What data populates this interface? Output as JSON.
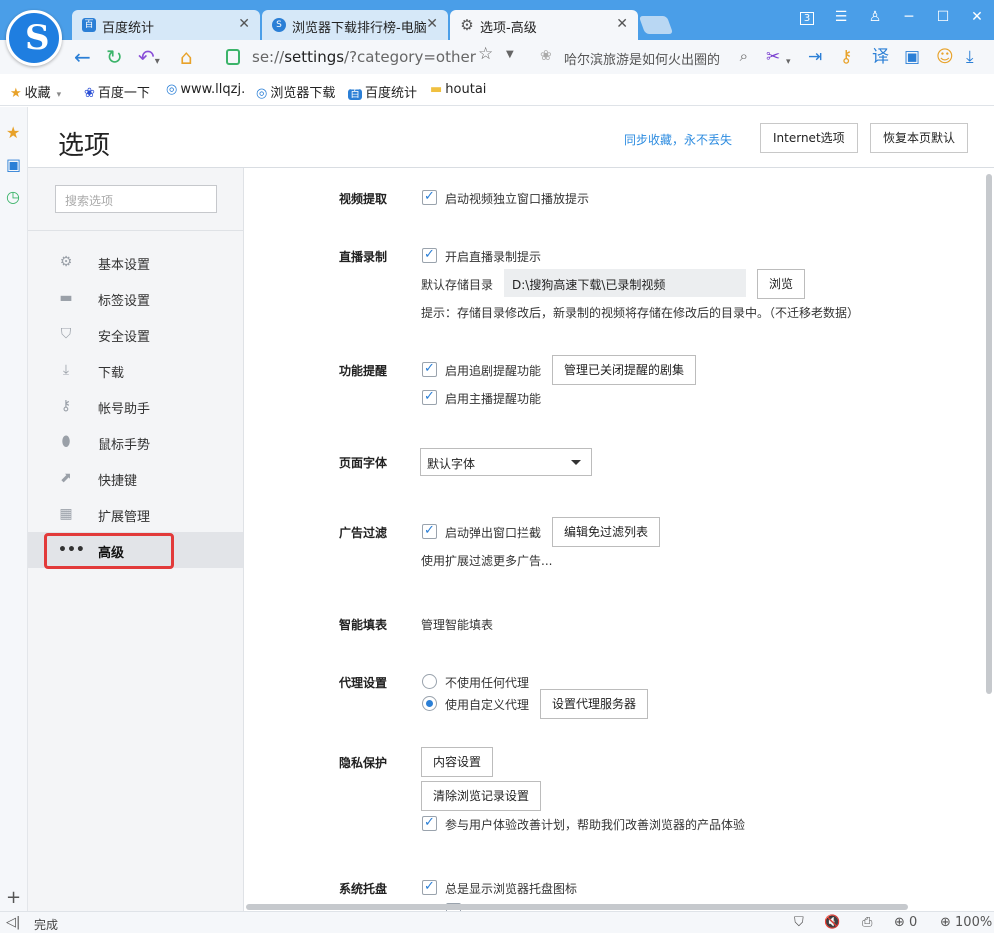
{
  "browser": {
    "tabs": [
      {
        "title": "百度统计",
        "icon": "baidu-tongji-icon"
      },
      {
        "title": "浏览器下载排行榜-电脑",
        "icon": "sogou-icon"
      },
      {
        "title": "选项-高级",
        "icon": "gear-icon"
      }
    ],
    "window_badge": "3",
    "url_prefix": "se://",
    "url_main": "settings",
    "url_suffix": "/?category=other",
    "search_text": "哈尔滨旅游是如何火出圈的",
    "bookmarks": [
      {
        "label": "收藏",
        "icon": "star-icon"
      },
      {
        "label": "百度一下",
        "icon": "baidu-paw-icon"
      },
      {
        "label": "www.llqzj.",
        "icon": "sogou-icon"
      },
      {
        "label": "浏览器下载",
        "icon": "sogou-icon"
      },
      {
        "label": "百度统计",
        "icon": "baidu-tongji-icon"
      },
      {
        "label": "houtai",
        "icon": "folder-icon"
      }
    ],
    "status": "完成",
    "zoom": "100%",
    "download_count": "0"
  },
  "settings": {
    "title": "选项",
    "sync_link": "同步收藏，永不丢失",
    "internet_options": "Internet选项",
    "restore_defaults": "恢复本页默认",
    "search_placeholder": "搜索选项",
    "nav": [
      {
        "label": "基本设置",
        "icon": "gear-icon"
      },
      {
        "label": "标签设置",
        "icon": "tab-icon"
      },
      {
        "label": "安全设置",
        "icon": "shield-check-icon"
      },
      {
        "label": "下载",
        "icon": "download-icon"
      },
      {
        "label": "帐号助手",
        "icon": "key-icon"
      },
      {
        "label": "鼠标手势",
        "icon": "mouse-icon"
      },
      {
        "label": "快捷键",
        "icon": "shortcut-arrow-icon"
      },
      {
        "label": "扩展管理",
        "icon": "grid-icon"
      },
      {
        "label": "高级",
        "icon": "more-dots-icon"
      }
    ],
    "active_nav": "高级",
    "sections": {
      "video": {
        "label": "视频提取",
        "checkbox": "启动视频独立窗口播放提示",
        "checked": true
      },
      "live": {
        "label": "直播录制",
        "checkbox": "开启直播录制提示",
        "checked": true,
        "dir_label": "默认存储目录",
        "dir_value": "D:\\搜狗高速下载\\已录制视频",
        "browse": "浏览",
        "hint": "提示：存储目录修改后，新录制的视频将存储在修改后的目录中。（不迁移老数据）"
      },
      "feature": {
        "label": "功能提醒",
        "checkbox1": "启用追剧提醒功能",
        "checked1": true,
        "manage_button": "管理已关闭提醒的剧集",
        "checkbox2": "启用主播提醒功能",
        "checked2": true
      },
      "font": {
        "label": "页面字体",
        "selected": "默认字体"
      },
      "adblock": {
        "label": "广告过滤",
        "checkbox": "启动弹出窗口拦截",
        "checked": true,
        "edit_button": "编辑免过滤列表",
        "more": "使用扩展过滤更多广告..."
      },
      "autofill": {
        "label": "智能填表",
        "link": "管理智能填表"
      },
      "proxy": {
        "label": "代理设置",
        "option1": "不使用任何代理",
        "option2": "使用自定义代理",
        "selected": "使用自定义代理",
        "server_button": "设置代理服务器"
      },
      "privacy": {
        "label": "隐私保护",
        "content_button": "内容设置",
        "clear_button": "清除浏览记录设置",
        "checkbox": "参与用户体验改善计划，帮助我们改善浏览器的产品体验",
        "checked": true
      },
      "tray": {
        "label": "系统托盘",
        "checkbox": "总是显示浏览器托盘图标",
        "checked": true
      }
    }
  }
}
